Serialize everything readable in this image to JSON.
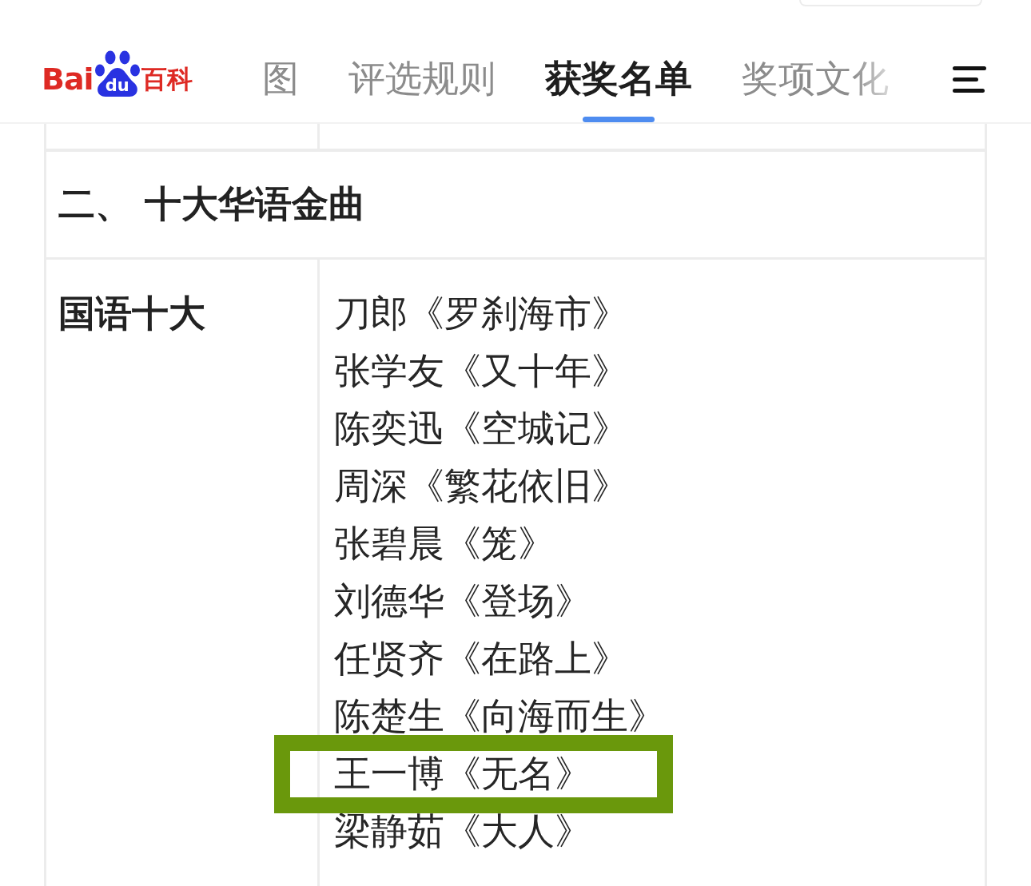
{
  "logo": {
    "text": "Bai",
    "badge": "du",
    "suffix": "百科"
  },
  "tabs": [
    {
      "label": "图",
      "selected": false
    },
    {
      "label": "评选规则",
      "selected": false
    },
    {
      "label": "获奖名单",
      "selected": true
    },
    {
      "label": "奖项文化",
      "selected": false
    }
  ],
  "table": {
    "section_title": "二、 十大华语金曲",
    "rows": [
      {
        "label": "国语十大",
        "items": [
          {
            "text": "刀郎《罗刹海市》",
            "highlighted": false
          },
          {
            "text": "张学友《又十年》",
            "highlighted": false
          },
          {
            "text": "陈奕迅《空城记》",
            "highlighted": false
          },
          {
            "text": "周深《繁花依旧》",
            "highlighted": false
          },
          {
            "text": "张碧晨《笼》",
            "highlighted": false
          },
          {
            "text": "刘德华《登场》",
            "highlighted": false
          },
          {
            "text": "任贤齐《在路上》",
            "highlighted": false
          },
          {
            "text": "陈楚生《向海而生》",
            "highlighted": false
          },
          {
            "text": "王一博《无名》",
            "highlighted": true
          },
          {
            "text": "梁静茹《大人》",
            "highlighted": false
          }
        ]
      }
    ]
  }
}
